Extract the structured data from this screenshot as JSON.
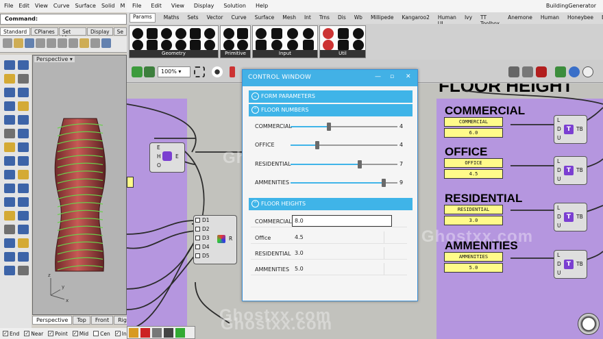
{
  "rhino": {
    "menu": [
      "File",
      "Edit",
      "View",
      "Curve",
      "Surface",
      "Solid",
      "M"
    ],
    "command_label": "Command:",
    "tabs": [
      "Standard",
      "CPlanes",
      "Set View",
      "Display",
      "Se"
    ],
    "viewport_title": "Perspective",
    "viewport_tabs": [
      "Perspective",
      "Top",
      "Front",
      "Righ"
    ],
    "osnaps": [
      {
        "label": "End",
        "checked": true
      },
      {
        "label": "Near",
        "checked": true
      },
      {
        "label": "Point",
        "checked": true
      },
      {
        "label": "Mid",
        "checked": true
      },
      {
        "label": "Cen",
        "checked": false
      },
      {
        "label": "Int",
        "checked": true
      }
    ],
    "axis_labels": [
      "z",
      "x",
      "y"
    ]
  },
  "gh": {
    "menu": [
      "File",
      "Edit",
      "View",
      "Display",
      "Solution",
      "Help"
    ],
    "doc_title": "BuildingGenerator",
    "tabs": [
      "Params",
      "Maths",
      "Sets",
      "Vector",
      "Curve",
      "Surface",
      "Mesh",
      "Int",
      "Trns",
      "Dis",
      "Wb",
      "Millipede",
      "Kangaroo2",
      "Human UI",
      "Ivy",
      "TT Toolbox",
      "Anemone",
      "Human",
      "Honeybee",
      "Extra"
    ],
    "ribbon_groups": [
      "Geometry",
      "Primitive",
      "Input",
      "Util"
    ],
    "zoom": "100%"
  },
  "canvas": {
    "header_title": "FLOOR HEIGHT",
    "groups": [
      {
        "label": "COMMERCIAL",
        "panel_title": "COMMERCIAL",
        "panel_value": "6.0"
      },
      {
        "label": "OFFICE",
        "panel_title": "OFFICE",
        "panel_value": "4.5"
      },
      {
        "label": "RESIDENTIAL",
        "panel_title": "RESIDENTIAL",
        "panel_value": "3.0"
      },
      {
        "label": "AMMENITIES",
        "panel_title": "AMMENITIES",
        "panel_value": "5.0"
      }
    ],
    "comp_ports_in": [
      "L",
      "D",
      "U"
    ],
    "comp_icon": "T",
    "comp_out": "TB",
    "expr_ports": [
      "E",
      "H",
      "O"
    ],
    "expr_out": "E",
    "merge_ports": [
      "D1",
      "D2",
      "D3",
      "D4",
      "D5"
    ],
    "merge_out": "R",
    "watermark": "Ghostxx.com"
  },
  "control_window": {
    "title": "CONTROL WINDOW",
    "sections": {
      "form": "FORM PARAMETERS",
      "numbers": "FLOOR NUMBERS",
      "heights": "FLOOR HEIGHTS"
    },
    "sliders": [
      {
        "label": "COMMERCIAL",
        "value": "4",
        "fraction": 0.36
      },
      {
        "label": "OFFICE",
        "value": "4",
        "fraction": 0.25
      },
      {
        "label": "RESIDENTIAL",
        "value": "7",
        "fraction": 0.65
      },
      {
        "label": "AMMENITIES",
        "value": "9",
        "fraction": 0.87
      }
    ],
    "heights": [
      {
        "label": "COMMERCIAL",
        "value": "8.0",
        "focused": true
      },
      {
        "label": "Office",
        "value": "4.5",
        "focused": false
      },
      {
        "label": "RESIDENTIAL",
        "value": "3.0",
        "focused": false
      },
      {
        "label": "AMMENITIES",
        "value": "5.0",
        "focused": false
      }
    ]
  },
  "colors": {
    "accent": "#42b1e6",
    "group_purple": "#b493e0",
    "panel_yellow": "#fffb8a"
  }
}
